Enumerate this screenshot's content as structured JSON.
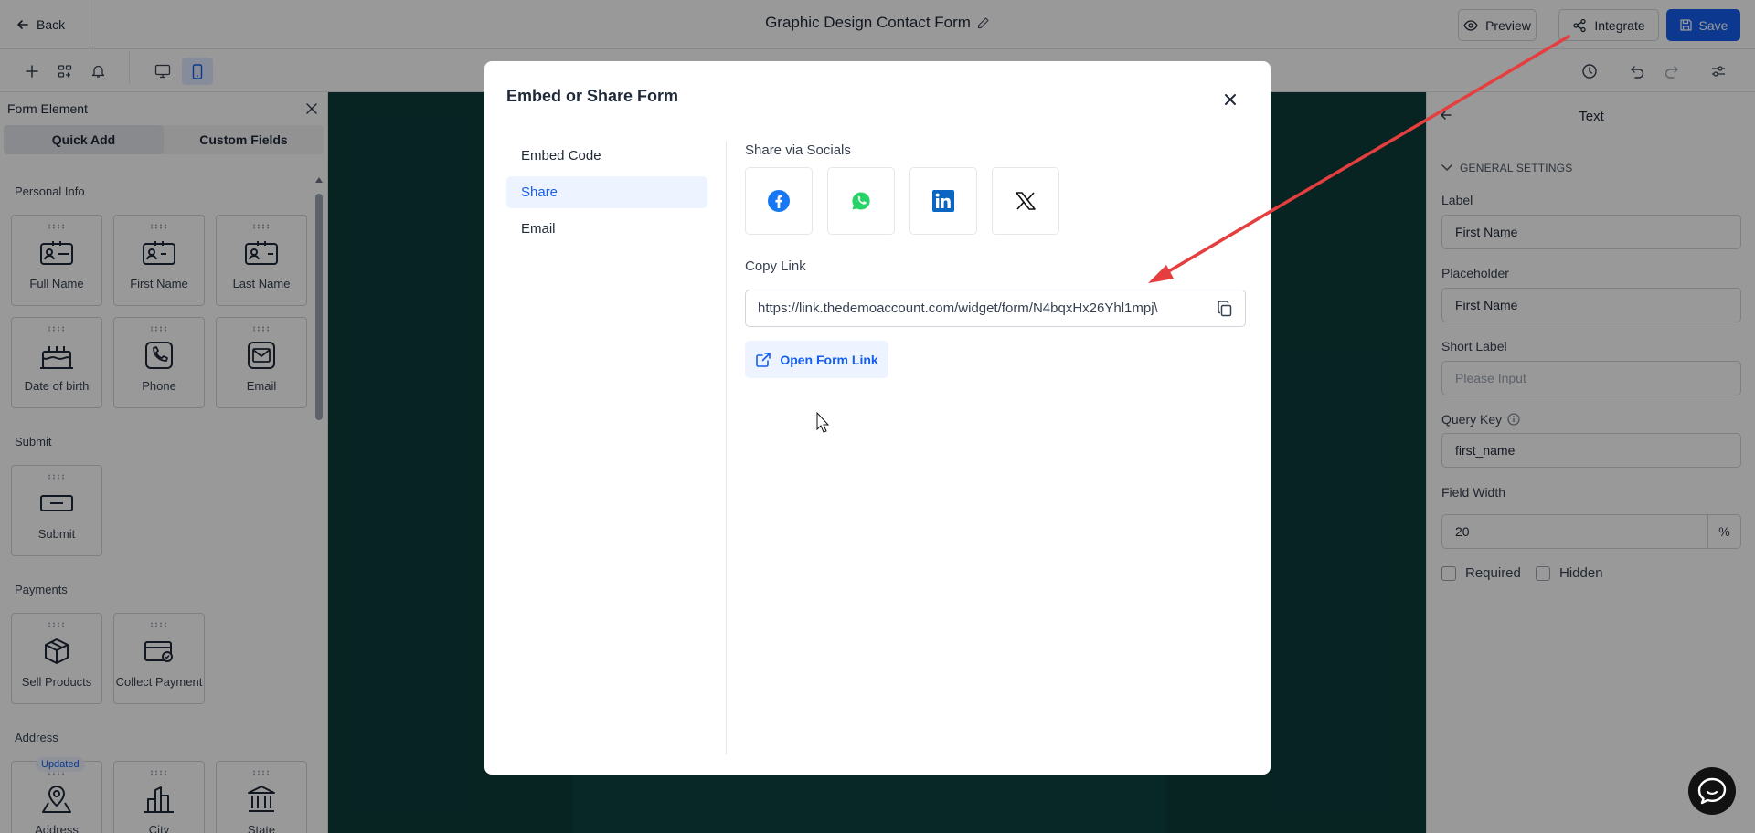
{
  "header": {
    "back_label": "Back",
    "form_title": "Graphic Design Contact Form",
    "preview_label": "Preview",
    "integrate_label": "Integrate",
    "save_label": "Save"
  },
  "left_panel": {
    "title": "Form Element",
    "tabs": [
      "Quick Add",
      "Custom Fields"
    ],
    "sections": {
      "personal_info": "Personal Info",
      "submit": "Submit",
      "payments": "Payments",
      "address": "Address"
    },
    "tiles": {
      "full_name": "Full Name",
      "first_name": "First Name",
      "last_name": "Last Name",
      "date_of_birth": "Date of birth",
      "phone": "Phone",
      "email": "Email",
      "submit": "Submit",
      "sell_products": "Sell Products",
      "collect_payment": "Collect Payment",
      "address": "Address",
      "city": "City",
      "state": "State"
    },
    "updated_badge": "Updated"
  },
  "right_panel": {
    "title": "Text",
    "general_settings": "GENERAL SETTINGS",
    "label_title": "Label",
    "label_value": "First Name",
    "placeholder_title": "Placeholder",
    "placeholder_value": "First Name",
    "short_label_title": "Short Label",
    "short_label_placeholder": "Please Input",
    "query_key_title": "Query Key",
    "query_key_value": "first_name",
    "field_width_title": "Field Width",
    "field_width_value": "20",
    "field_width_unit": "%",
    "required_label": "Required",
    "hidden_label": "Hidden"
  },
  "modal": {
    "title": "Embed or Share Form",
    "nav": [
      "Embed Code",
      "Share",
      "Email"
    ],
    "active_nav": "Share",
    "socials_title": "Share via Socials",
    "socials": [
      "facebook",
      "whatsapp",
      "linkedin",
      "x"
    ],
    "copy_link_title": "Copy Link",
    "link_url": "https://link.thedemoaccount.com/widget/form/N4bqxHx26Yhl1mpj\\",
    "open_link_label": "Open Form Link"
  },
  "colors": {
    "primary": "#155eef",
    "annotation_arrow": "#e53e3e",
    "canvas_bg": "#0d3b3a",
    "facebook": "#1877f2",
    "whatsapp": "#25d366",
    "linkedin": "#0a66c2"
  }
}
